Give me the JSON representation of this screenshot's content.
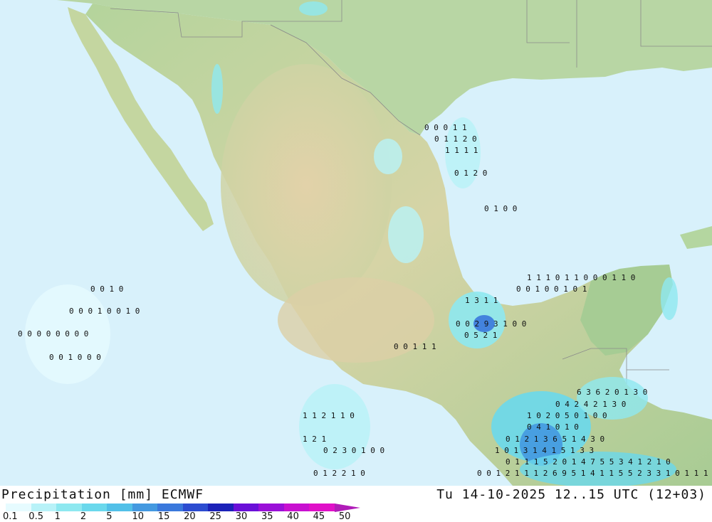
{
  "footer": {
    "title": "Precipitation [mm] ECMWF",
    "datetime": "Tu 14-10-2025 12..15 UTC (12+03)"
  },
  "legend": {
    "labels": [
      "0.1",
      "0.5",
      "1",
      "2",
      "5",
      "10",
      "15",
      "20",
      "25",
      "30",
      "35",
      "40",
      "45",
      "50"
    ],
    "colors": [
      "#e6fbff",
      "#b8f2f8",
      "#8ee8f0",
      "#6ad8ec",
      "#52c0e8",
      "#4499e0",
      "#3a78dc",
      "#2c4cd0",
      "#1c22b8",
      "#6a10d8",
      "#9a10d8",
      "#c810d0",
      "#e010c8",
      "#b01cb8"
    ]
  },
  "colors": {
    "sea": "#d8f1fb",
    "land_low": "#a8d098",
    "land_mid": "#c8d8a8",
    "land_high": "#e0cfa8",
    "border": "#8a8a8a"
  },
  "map_labels": {
    "row_a": "0 0 0 1 1",
    "row_b": "0 1 1 2 0",
    "row_c": "1 1 1 1",
    "row_d": "0 1 2 0",
    "row_e": "0 1 0 0",
    "row_f": "0 0 1 0",
    "row_g": "0 0 0 1 0 0 1 0",
    "row_h": "0 0 0 0 0 0 0 0",
    "row_i": "0 0 1 0 0 0",
    "row_j": "1 1 2 1 1 0",
    "row_k": "0 1 2 1 3 6 5 1 4 3 0",
    "row_l": "1 0 1 3 1 4 1 5 1 3 3",
    "row_m": "0 1 1 1 5 2 0 1 4 7 5 5 3 4 1 2 1 0",
    "row_n": "0 0 1 2 1 1 1 2 6 9 5 1 4 1 1 5 5 2 3 3 1 0 1 1 1",
    "row_o": "0 0 2 9 3 1 0 0",
    "row_p": "0 5 2 1",
    "row_q": "1 1 1 0 1 1 0 0 0 1 1 0",
    "row_r": "0 0 1 0 0 1 0 1",
    "row_s": "6 3 6 2 0 1 3 0",
    "row_t": "0 4 2 4 2 1 3 0",
    "row_u": "1 0 2 0 5 0 1 0 0",
    "row_v": "0 4 1 0 1 0",
    "row_w": "0 2 3 0 1 0 0",
    "row_x": "0 1 2 2 1 0",
    "row_y": "1 2 1",
    "row_z": "0 0 1 1 1",
    "row_z2": "1 3 1 1"
  }
}
